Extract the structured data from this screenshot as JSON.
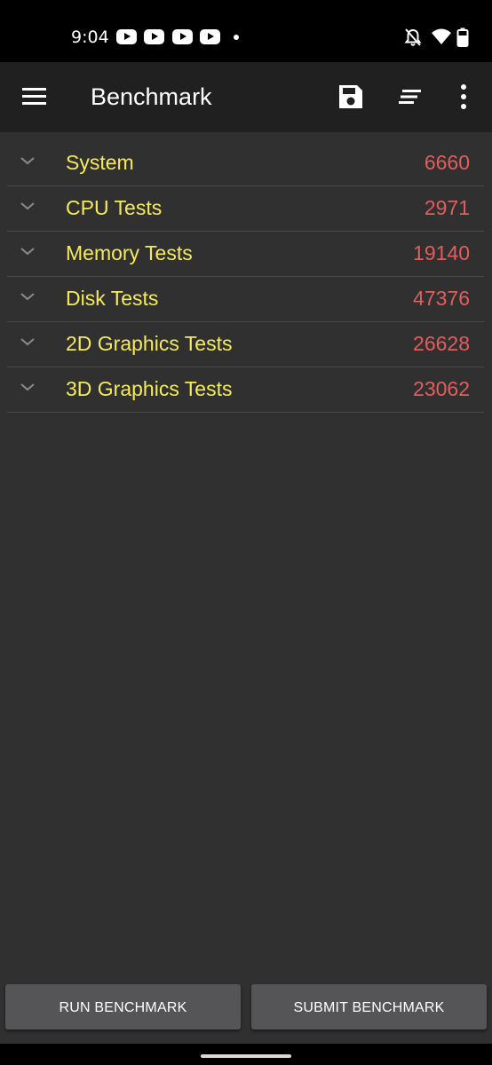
{
  "status_bar": {
    "time": "9:04",
    "notification_icons": [
      "youtube-icon",
      "youtube-icon",
      "youtube-icon",
      "youtube-icon",
      "dot-icon"
    ],
    "right_icons": [
      "bell-off-icon",
      "wifi-icon",
      "battery-icon"
    ]
  },
  "app_bar": {
    "title": "Benchmark",
    "icons": [
      "menu-icon",
      "save-icon",
      "sort-icon",
      "more-vert-icon"
    ]
  },
  "results": [
    {
      "label": "System",
      "score": "6660"
    },
    {
      "label": "CPU Tests",
      "score": "2971"
    },
    {
      "label": "Memory Tests",
      "score": "19140"
    },
    {
      "label": "Disk Tests",
      "score": "47376"
    },
    {
      "label": "2D Graphics Tests",
      "score": "26628"
    },
    {
      "label": "3D Graphics Tests",
      "score": "23062"
    }
  ],
  "buttons": {
    "run": "RUN BENCHMARK",
    "submit": "SUBMIT BENCHMARK"
  },
  "colors": {
    "label": "#f5ea5a",
    "score": "#e35d5d",
    "background": "#303030",
    "app_bar": "#202020",
    "button": "#555558"
  }
}
